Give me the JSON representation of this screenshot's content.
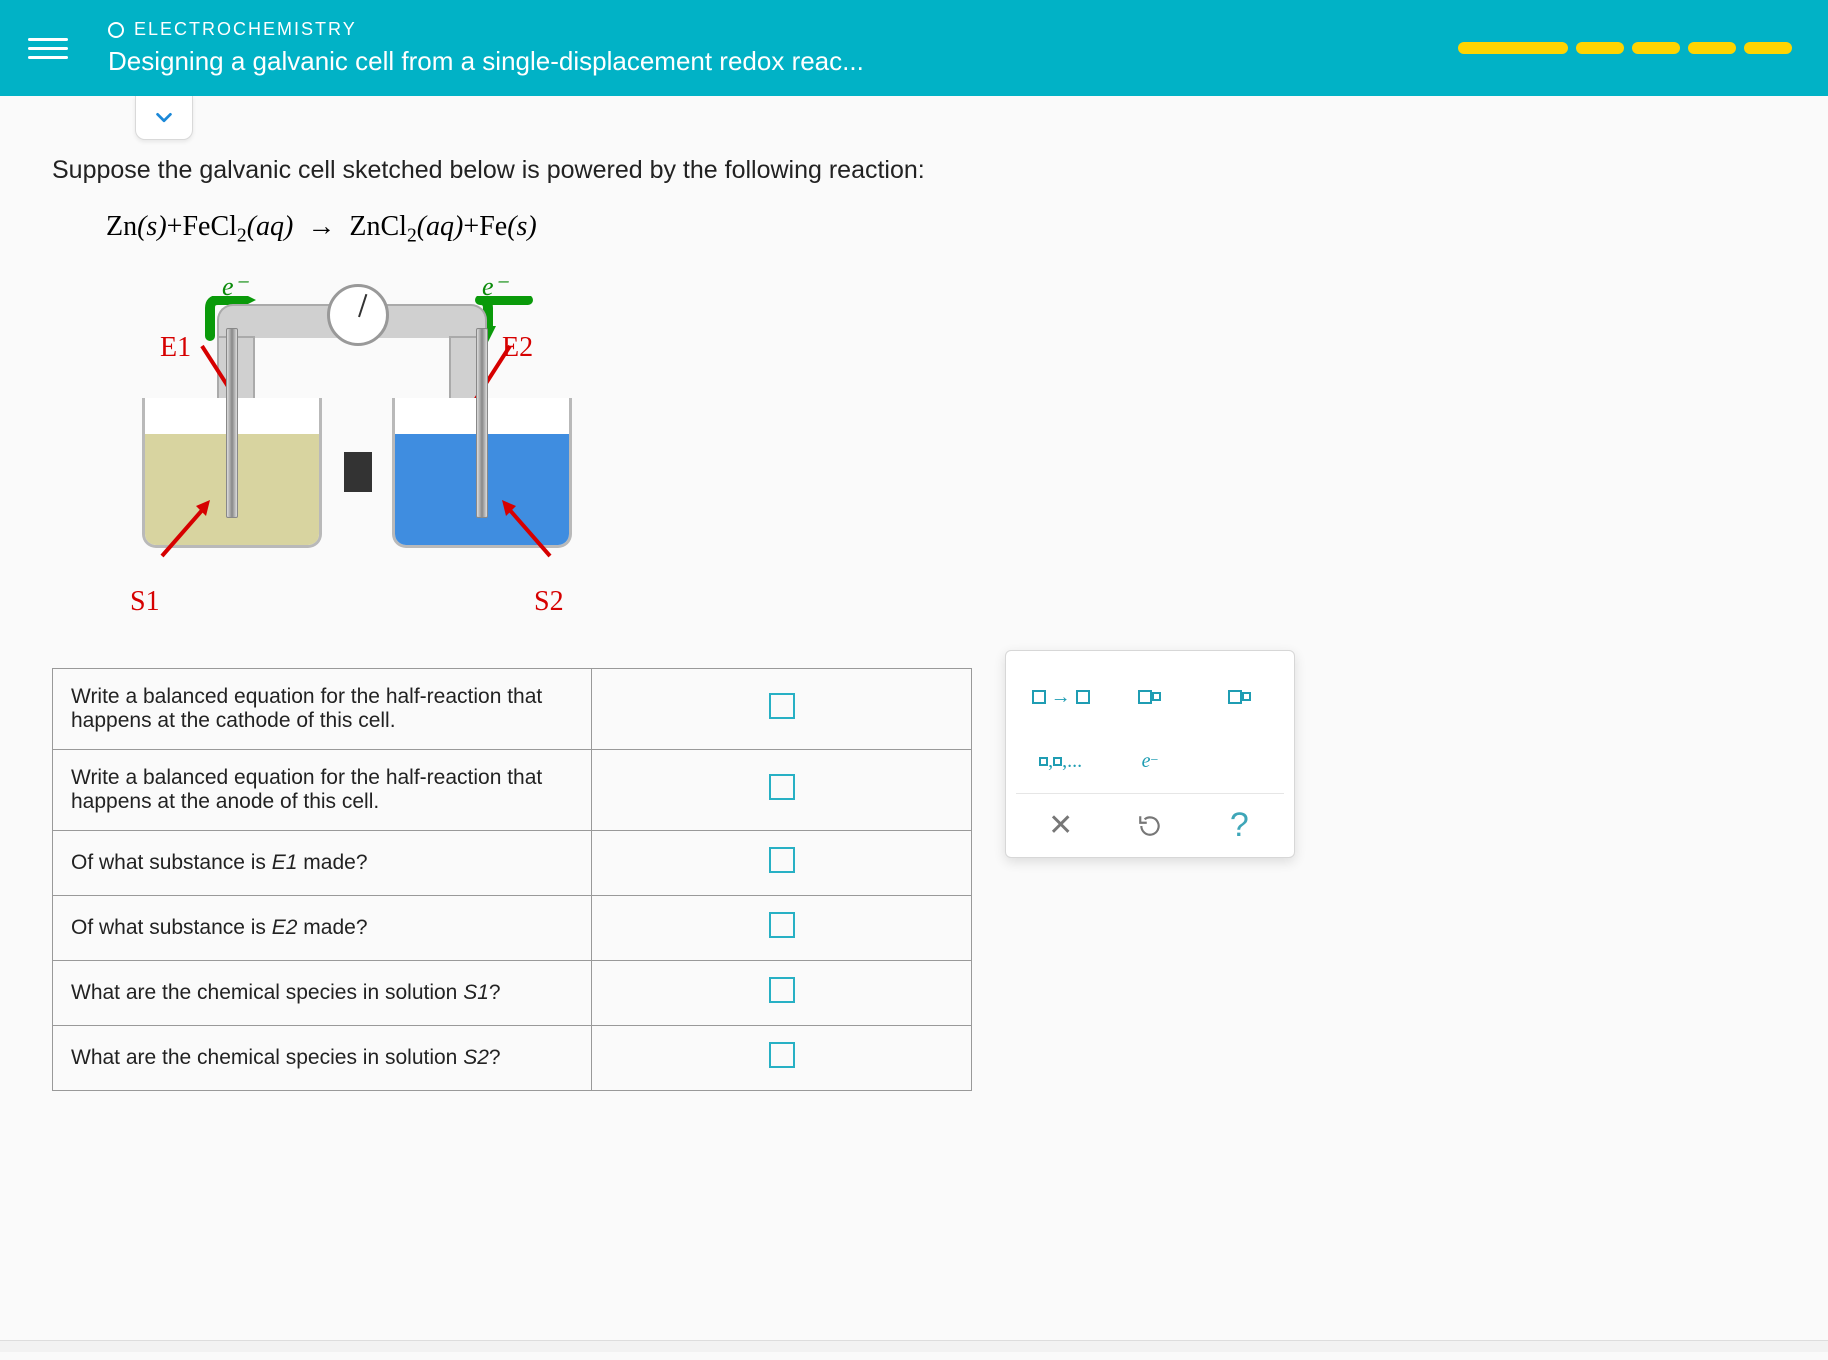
{
  "header": {
    "chapter": "ELECTROCHEMISTRY",
    "title": "Designing a galvanic cell from a single-displacement redox reac..."
  },
  "prompt": "Suppose the galvanic cell sketched below is powered by the following reaction:",
  "equation": {
    "lhs1": "Zn",
    "state1": "(s)",
    "lhs2": "FeCl",
    "lhs2_sub": "2",
    "state2": "(aq)",
    "arrow": "→",
    "rhs1": "ZnCl",
    "rhs1_sub": "2",
    "state3": "(aq)",
    "rhs2": "Fe",
    "state4": "(s)"
  },
  "diagram": {
    "e_minus_left": "e⁻",
    "e_minus_right": "e⁻",
    "E1": "E1",
    "E2": "E2",
    "S1": "S1",
    "S2": "S2"
  },
  "questions": [
    "Write a balanced equation for the half-reaction that happens at the cathode of this cell.",
    "Write a balanced equation for the half-reaction that happens at the anode of this cell.",
    "Of what substance is E1 made?",
    "Of what substance is E2 made?",
    "What are the chemical species in solution S1?",
    "What are the chemical species in solution S2?"
  ],
  "tools": {
    "arrow": "→",
    "list": "▢,▢,...",
    "electron": "e⁻",
    "clear": "✕",
    "reset": "↺",
    "help": "?"
  }
}
